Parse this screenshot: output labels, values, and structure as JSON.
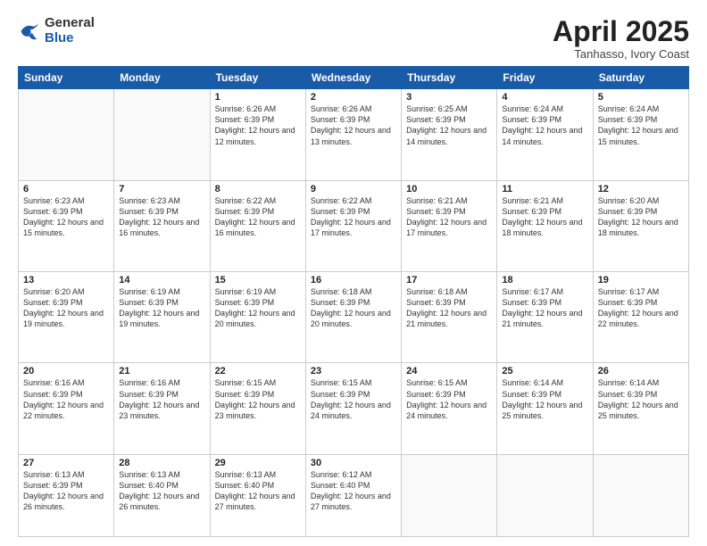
{
  "logo": {
    "general": "General",
    "blue": "Blue"
  },
  "title": "April 2025",
  "location": "Tanhasso, Ivory Coast",
  "days_of_week": [
    "Sunday",
    "Monday",
    "Tuesday",
    "Wednesday",
    "Thursday",
    "Friday",
    "Saturday"
  ],
  "weeks": [
    [
      {
        "day": "",
        "info": ""
      },
      {
        "day": "",
        "info": ""
      },
      {
        "day": "1",
        "info": "Sunrise: 6:26 AM\nSunset: 6:39 PM\nDaylight: 12 hours and 12 minutes."
      },
      {
        "day": "2",
        "info": "Sunrise: 6:26 AM\nSunset: 6:39 PM\nDaylight: 12 hours and 13 minutes."
      },
      {
        "day": "3",
        "info": "Sunrise: 6:25 AM\nSunset: 6:39 PM\nDaylight: 12 hours and 14 minutes."
      },
      {
        "day": "4",
        "info": "Sunrise: 6:24 AM\nSunset: 6:39 PM\nDaylight: 12 hours and 14 minutes."
      },
      {
        "day": "5",
        "info": "Sunrise: 6:24 AM\nSunset: 6:39 PM\nDaylight: 12 hours and 15 minutes."
      }
    ],
    [
      {
        "day": "6",
        "info": "Sunrise: 6:23 AM\nSunset: 6:39 PM\nDaylight: 12 hours and 15 minutes."
      },
      {
        "day": "7",
        "info": "Sunrise: 6:23 AM\nSunset: 6:39 PM\nDaylight: 12 hours and 16 minutes."
      },
      {
        "day": "8",
        "info": "Sunrise: 6:22 AM\nSunset: 6:39 PM\nDaylight: 12 hours and 16 minutes."
      },
      {
        "day": "9",
        "info": "Sunrise: 6:22 AM\nSunset: 6:39 PM\nDaylight: 12 hours and 17 minutes."
      },
      {
        "day": "10",
        "info": "Sunrise: 6:21 AM\nSunset: 6:39 PM\nDaylight: 12 hours and 17 minutes."
      },
      {
        "day": "11",
        "info": "Sunrise: 6:21 AM\nSunset: 6:39 PM\nDaylight: 12 hours and 18 minutes."
      },
      {
        "day": "12",
        "info": "Sunrise: 6:20 AM\nSunset: 6:39 PM\nDaylight: 12 hours and 18 minutes."
      }
    ],
    [
      {
        "day": "13",
        "info": "Sunrise: 6:20 AM\nSunset: 6:39 PM\nDaylight: 12 hours and 19 minutes."
      },
      {
        "day": "14",
        "info": "Sunrise: 6:19 AM\nSunset: 6:39 PM\nDaylight: 12 hours and 19 minutes."
      },
      {
        "day": "15",
        "info": "Sunrise: 6:19 AM\nSunset: 6:39 PM\nDaylight: 12 hours and 20 minutes."
      },
      {
        "day": "16",
        "info": "Sunrise: 6:18 AM\nSunset: 6:39 PM\nDaylight: 12 hours and 20 minutes."
      },
      {
        "day": "17",
        "info": "Sunrise: 6:18 AM\nSunset: 6:39 PM\nDaylight: 12 hours and 21 minutes."
      },
      {
        "day": "18",
        "info": "Sunrise: 6:17 AM\nSunset: 6:39 PM\nDaylight: 12 hours and 21 minutes."
      },
      {
        "day": "19",
        "info": "Sunrise: 6:17 AM\nSunset: 6:39 PM\nDaylight: 12 hours and 22 minutes."
      }
    ],
    [
      {
        "day": "20",
        "info": "Sunrise: 6:16 AM\nSunset: 6:39 PM\nDaylight: 12 hours and 22 minutes."
      },
      {
        "day": "21",
        "info": "Sunrise: 6:16 AM\nSunset: 6:39 PM\nDaylight: 12 hours and 23 minutes."
      },
      {
        "day": "22",
        "info": "Sunrise: 6:15 AM\nSunset: 6:39 PM\nDaylight: 12 hours and 23 minutes."
      },
      {
        "day": "23",
        "info": "Sunrise: 6:15 AM\nSunset: 6:39 PM\nDaylight: 12 hours and 24 minutes."
      },
      {
        "day": "24",
        "info": "Sunrise: 6:15 AM\nSunset: 6:39 PM\nDaylight: 12 hours and 24 minutes."
      },
      {
        "day": "25",
        "info": "Sunrise: 6:14 AM\nSunset: 6:39 PM\nDaylight: 12 hours and 25 minutes."
      },
      {
        "day": "26",
        "info": "Sunrise: 6:14 AM\nSunset: 6:39 PM\nDaylight: 12 hours and 25 minutes."
      }
    ],
    [
      {
        "day": "27",
        "info": "Sunrise: 6:13 AM\nSunset: 6:39 PM\nDaylight: 12 hours and 26 minutes."
      },
      {
        "day": "28",
        "info": "Sunrise: 6:13 AM\nSunset: 6:40 PM\nDaylight: 12 hours and 26 minutes."
      },
      {
        "day": "29",
        "info": "Sunrise: 6:13 AM\nSunset: 6:40 PM\nDaylight: 12 hours and 27 minutes."
      },
      {
        "day": "30",
        "info": "Sunrise: 6:12 AM\nSunset: 6:40 PM\nDaylight: 12 hours and 27 minutes."
      },
      {
        "day": "",
        "info": ""
      },
      {
        "day": "",
        "info": ""
      },
      {
        "day": "",
        "info": ""
      }
    ]
  ]
}
